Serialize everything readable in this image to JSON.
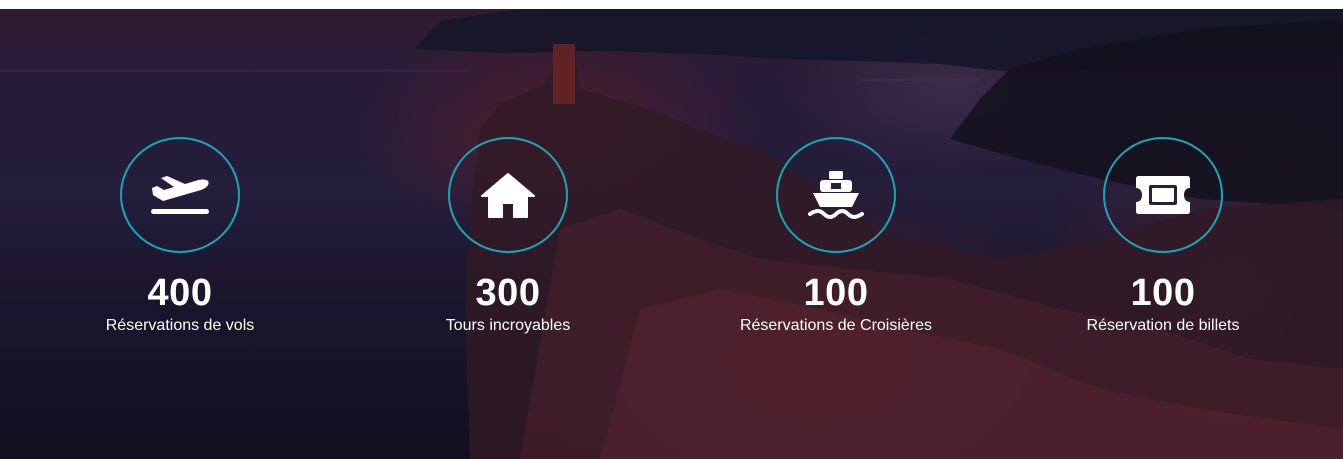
{
  "stats": [
    {
      "icon": "airplane-departure-icon",
      "count": "400",
      "label": "Réservations de vols"
    },
    {
      "icon": "home-icon",
      "count": "300",
      "label": "Tours incroyables"
    },
    {
      "icon": "ship-icon",
      "count": "100",
      "label": "Réservations de Croisières"
    },
    {
      "icon": "ticket-icon",
      "count": "100",
      "label": "Réservation de billets"
    }
  ],
  "colors": {
    "accent_ring": "#1fa2b6",
    "text": "#ffffff"
  }
}
